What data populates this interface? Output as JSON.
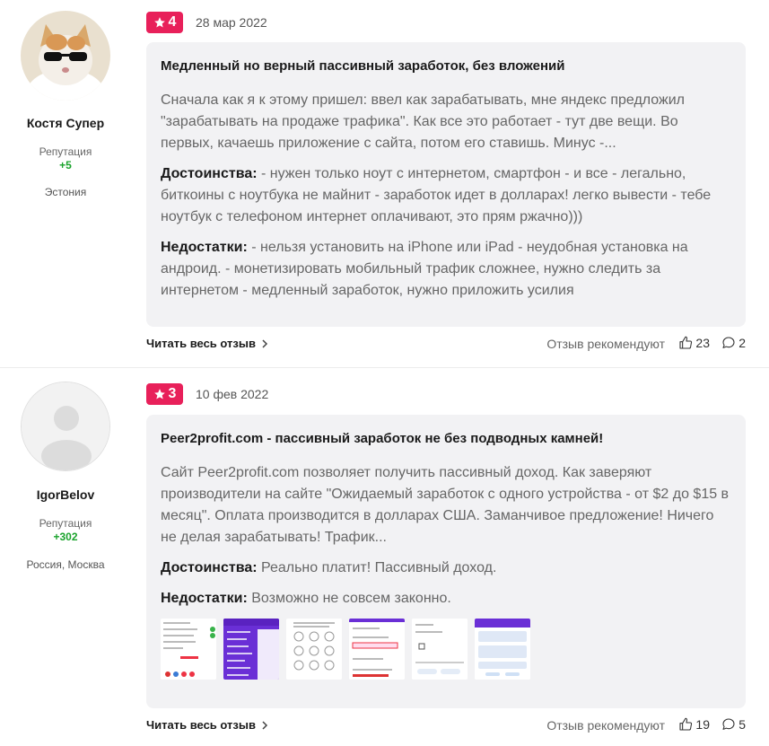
{
  "reviews": [
    {
      "author": {
        "name": "Костя Супер",
        "reputation_label": "Репутация",
        "reputation": "+5",
        "location": "Эстония"
      },
      "rating": "4",
      "date": "28 мар 2022",
      "title": "Медленный но верный пассивный заработок, без вложений",
      "text": "Сначала как я к этому пришел: ввел как зарабатывать, мне яндекс предложил \"зарабатывать на продаже трафика\". Как все это работает - тут две вещи. Во первых, качаешь приложение с сайта, потом его ставишь. Минус -...",
      "pros_label": "Достоинства:",
      "pros": " - нужен только ноут с интернетом, смартфон - и все - легально, биткоины с ноутбука не майнит - заработок идет в долларах! легко вывести - тебе ноутбук с телефоном интернет оплачивают, это прям ржачно)))",
      "cons_label": "Недостатки:",
      "cons": " - нельзя установить на iPhone или iPad - неудобная установка на андроид. - монетизировать мобильный трафик сложнее, нужно следить за интернетом - медленный заработок, нужно приложить усилия",
      "read_more": "Читать весь отзыв",
      "recommend_label": "Отзыв рекомендуют",
      "likes": "23",
      "comments": "2"
    },
    {
      "author": {
        "name": "IgorBelov",
        "reputation_label": "Репутация",
        "reputation": "+302",
        "location": "Россия, Москва"
      },
      "rating": "3",
      "date": "10 фев 2022",
      "title": "Peer2profit.com - пассивный заработок не без подводных камней!",
      "text": "Сайт Peer2profit.com позволяет получить пассивный доход. Как заверяют производители на сайте \"Ожидаемый заработок с одного устройства - от $2 до $15 в месяц\". Оплата производится в долларах США. Заманчивое предложение! Ничего не делая зарабатывать! Трафик...",
      "pros_label": "Достоинства:",
      "pros": " Реально платит! Пассивный доход.",
      "cons_label": "Недостатки:",
      "cons": " Возможно не совсем законно.",
      "read_more": "Читать весь отзыв",
      "recommend_label": "Отзыв рекомендуют",
      "likes": "19",
      "comments": "5"
    }
  ],
  "colors": {
    "badge": "#e8205a",
    "reputation": "#1aa32c",
    "card_bg": "#f2f2f4"
  },
  "icons": [
    "star-icon",
    "chevron-right-icon",
    "thumbs-up-icon",
    "comment-icon",
    "avatar-placeholder-icon"
  ]
}
